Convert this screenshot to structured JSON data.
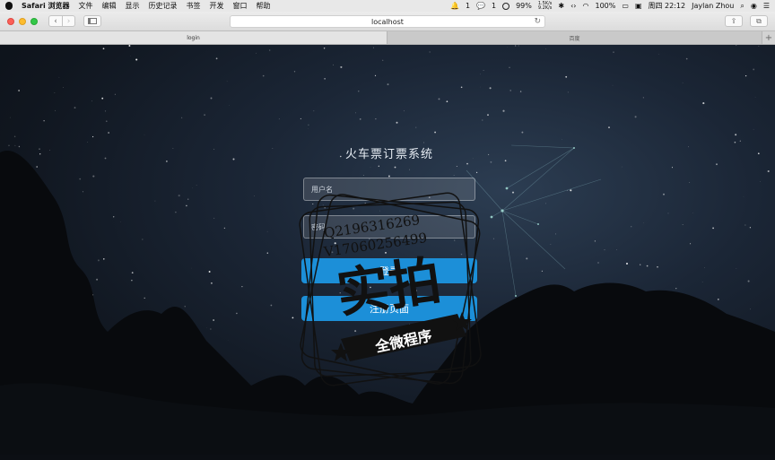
{
  "menubar": {
    "app_name": "Safari 浏览器",
    "menus": [
      "文件",
      "编辑",
      "显示",
      "历史记录",
      "书签",
      "开发",
      "窗口",
      "帮助"
    ],
    "status": {
      "notif1": "1",
      "notif2": "1",
      "battery_percent_1": "99%",
      "net_up": "1.5K/s",
      "net_down": "9.2K/s",
      "battery_percent_2": "100%",
      "datetime": "周四 22:12",
      "user": "Jaylan Zhou"
    }
  },
  "toolbar": {
    "back": "‹",
    "forward": "›",
    "url": "localhost",
    "reload": "↻"
  },
  "tabs": [
    {
      "label": "login",
      "active": true
    },
    {
      "label": "百度",
      "active": false
    }
  ],
  "tab_add": "+",
  "login": {
    "title": "火车票订票系统",
    "username_placeholder": "用户名",
    "password_placeholder": "密码",
    "login_button": "登录",
    "register_button": "注册页面"
  },
  "watermark": {
    "line1": "Q2196316269",
    "line2": "V17060256499",
    "big": "实拍",
    "ribbon": "全微程序"
  },
  "colors": {
    "accent": "#1c8fd8",
    "menubar_bg": "#e8e8e8"
  }
}
